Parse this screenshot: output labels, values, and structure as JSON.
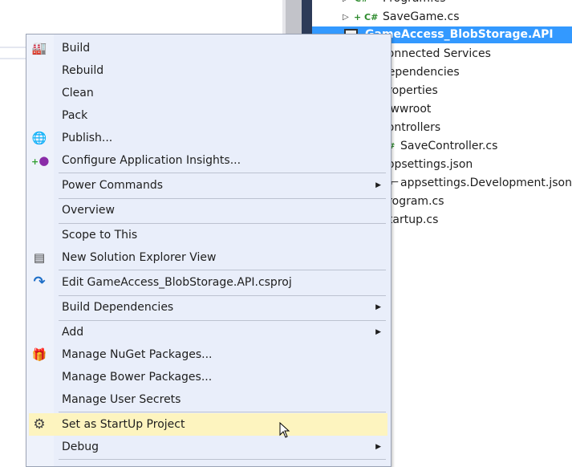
{
  "tree": {
    "items": [
      {
        "label": "Program.cs",
        "badge": "C#"
      },
      {
        "label": "SaveGame.cs",
        "badge": "C#"
      },
      {
        "label": "GameAccess_BlobStorage.API",
        "selected": true
      },
      {
        "label": "Connected Services"
      },
      {
        "label": "Dependencies"
      },
      {
        "label": "Properties"
      },
      {
        "label": "wwwroot"
      },
      {
        "label": "Controllers"
      },
      {
        "label": "SaveController.cs"
      },
      {
        "label": "appsettings.json"
      },
      {
        "label": "appsettings.Development.json"
      },
      {
        "label": "Program.cs"
      },
      {
        "label": "Startup.cs"
      }
    ],
    "selected_color": "#3399ff"
  },
  "menu": {
    "items": [
      {
        "label": "Build",
        "icon": "build-icon"
      },
      {
        "label": "Rebuild"
      },
      {
        "label": "Clean"
      },
      {
        "label": "Pack"
      },
      {
        "label": "Publish...",
        "icon": "globe-publish-icon"
      },
      {
        "label": "Configure Application Insights...",
        "icon": "lightbulb-icon"
      },
      {
        "label": "Power Commands",
        "submenu": true
      },
      {
        "label": "Overview"
      },
      {
        "label": "Scope to This"
      },
      {
        "label": "New Solution Explorer View",
        "icon": "window-icon"
      },
      {
        "label": "Edit GameAccess_BlobStorage.API.csproj",
        "icon": "redo-arrow-icon"
      },
      {
        "label": "Build Dependencies",
        "submenu": true
      },
      {
        "label": "Add",
        "submenu": true
      },
      {
        "label": "Manage NuGet Packages...",
        "icon": "gift-icon"
      },
      {
        "label": "Manage Bower Packages..."
      },
      {
        "label": "Manage User Secrets"
      },
      {
        "label": "Set as StartUp Project",
        "icon": "gear-icon",
        "highlighted": true
      },
      {
        "label": "Debug",
        "submenu": true
      }
    ],
    "highlight_color": "#fdf4bf"
  }
}
